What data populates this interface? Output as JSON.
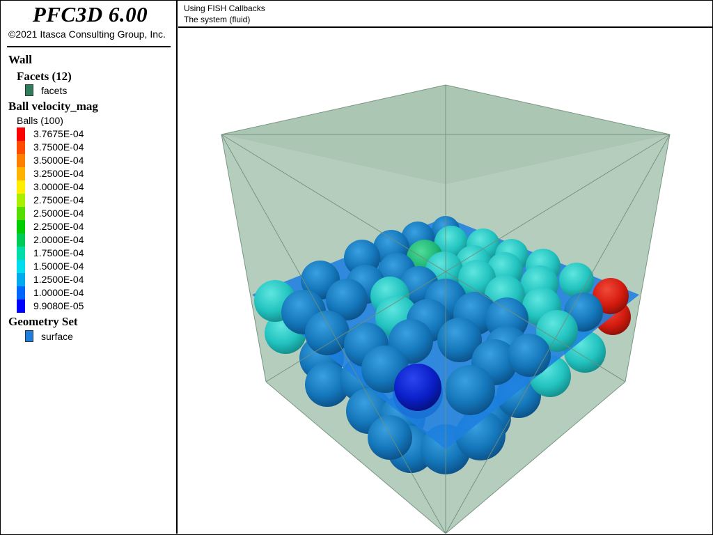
{
  "app": {
    "title": "PFC3D 6.00",
    "copyright": "©2021 Itasca Consulting Group, Inc."
  },
  "header": {
    "line1": "Using FISH Callbacks",
    "line2": "The system (fluid)"
  },
  "legend": {
    "wall": {
      "title": "Wall",
      "facets_title": "Facets (12)",
      "facets_label": "facets",
      "facets_color": "#2e7d5b"
    },
    "ball": {
      "title": "Ball velocity_mag",
      "subtitle": "Balls (100)",
      "scale": [
        {
          "label": "3.7675E-04",
          "color": "#ff0000"
        },
        {
          "label": "3.7500E-04",
          "color": "#ff4a00"
        },
        {
          "label": "3.5000E-04",
          "color": "#ff7f00"
        },
        {
          "label": "3.2500E-04",
          "color": "#ffb300"
        },
        {
          "label": "3.0000E-04",
          "color": "#ffee00"
        },
        {
          "label": "2.7500E-04",
          "color": "#aaee00"
        },
        {
          "label": "2.5000E-04",
          "color": "#55dd00"
        },
        {
          "label": "2.2500E-04",
          "color": "#00cc00"
        },
        {
          "label": "2.0000E-04",
          "color": "#00cc55"
        },
        {
          "label": "1.7500E-04",
          "color": "#00ddaa"
        },
        {
          "label": "1.5000E-04",
          "color": "#00ddee"
        },
        {
          "label": "1.2500E-04",
          "color": "#00aaee"
        },
        {
          "label": "1.0000E-04",
          "color": "#0066ff"
        },
        {
          "label": "9.9080E-05",
          "color": "#0000ff"
        }
      ]
    },
    "geometry": {
      "title": "Geometry Set",
      "surface_label": "surface",
      "surface_color": "#1e7fe0"
    }
  },
  "scene": {
    "box_face_color": "#8fb49a",
    "box_edge_color": "#6f8f7a",
    "plane_color": "#1e7fe0",
    "ball_blue": "#1477bb",
    "ball_teal": "#22c3c0",
    "ball_green": "#1fb574",
    "ball_deep_blue": "#0a1fc8",
    "ball_red": "#d41b0f"
  }
}
